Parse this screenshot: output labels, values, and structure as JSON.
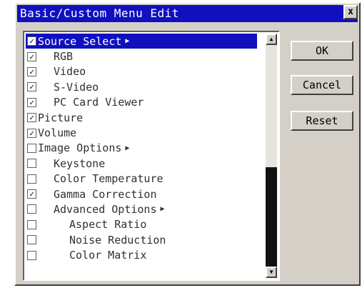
{
  "window": {
    "title": "Basic/Custom Menu Edit",
    "close_label": "x"
  },
  "list": {
    "items": [
      {
        "label": "Source Select",
        "checked": true,
        "indent": 0,
        "submenu": true,
        "selected": true
      },
      {
        "label": "RGB",
        "checked": true,
        "indent": 1,
        "submenu": false,
        "selected": false
      },
      {
        "label": "Video",
        "checked": true,
        "indent": 1,
        "submenu": false,
        "selected": false
      },
      {
        "label": "S-Video",
        "checked": true,
        "indent": 1,
        "submenu": false,
        "selected": false
      },
      {
        "label": "PC Card Viewer",
        "checked": true,
        "indent": 1,
        "submenu": false,
        "selected": false
      },
      {
        "label": "Picture",
        "checked": true,
        "indent": 0,
        "submenu": false,
        "selected": false
      },
      {
        "label": "Volume",
        "checked": true,
        "indent": 0,
        "submenu": false,
        "selected": false
      },
      {
        "label": "Image Options",
        "checked": false,
        "indent": 0,
        "submenu": true,
        "selected": false
      },
      {
        "label": "Keystone",
        "checked": false,
        "indent": 1,
        "submenu": false,
        "selected": false
      },
      {
        "label": "Color Temperature",
        "checked": false,
        "indent": 1,
        "submenu": false,
        "selected": false
      },
      {
        "label": "Gamma Correction",
        "checked": true,
        "indent": 1,
        "submenu": false,
        "selected": false
      },
      {
        "label": "Advanced Options",
        "checked": false,
        "indent": 1,
        "submenu": true,
        "selected": false
      },
      {
        "label": "Aspect Ratio",
        "checked": false,
        "indent": 2,
        "submenu": false,
        "selected": false
      },
      {
        "label": "Noise Reduction",
        "checked": false,
        "indent": 2,
        "submenu": false,
        "selected": false
      },
      {
        "label": "Color Matrix",
        "checked": false,
        "indent": 2,
        "submenu": false,
        "selected": false
      }
    ],
    "scroll_position_fraction": 0.55
  },
  "buttons": {
    "ok": "OK",
    "cancel": "Cancel",
    "reset": "Reset"
  },
  "colors": {
    "title_bar": "#1010c0",
    "selection": "#1010c0",
    "face": "#d4d0c8"
  }
}
